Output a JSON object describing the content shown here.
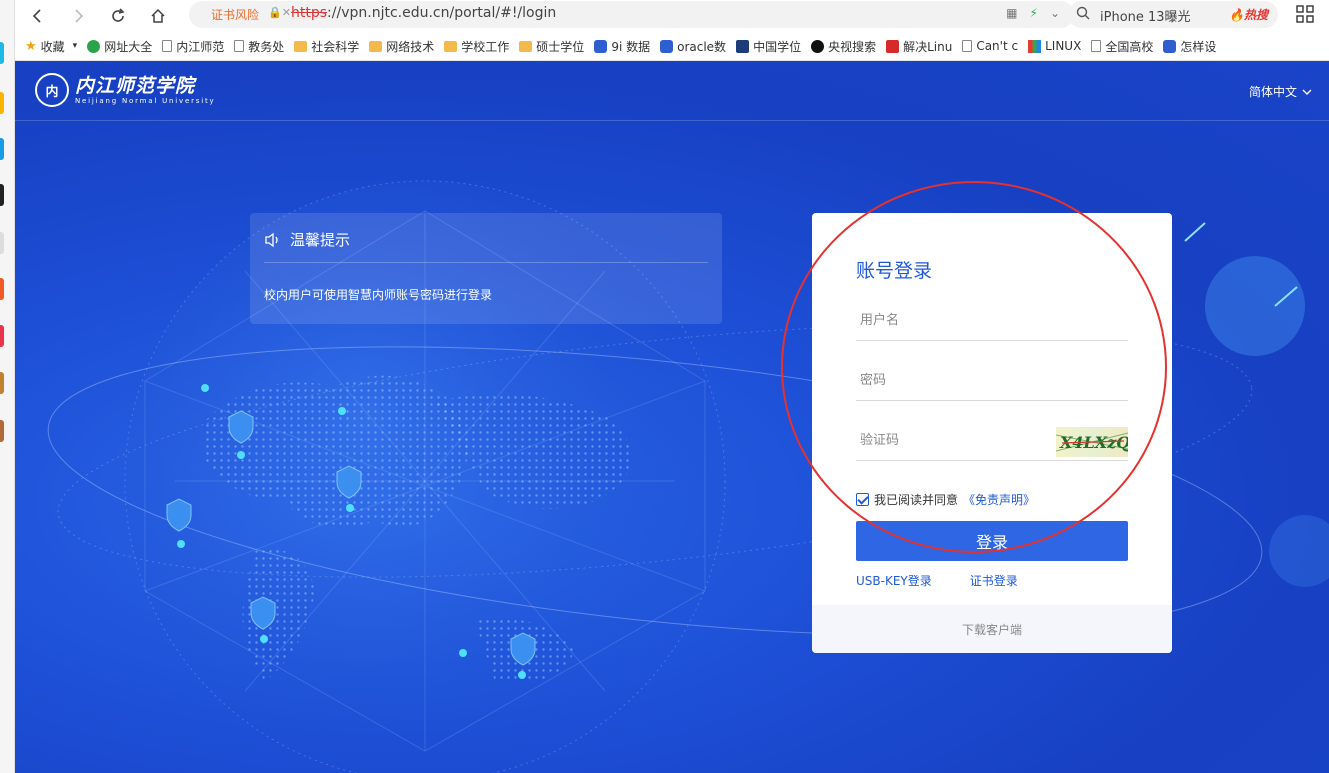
{
  "browser": {
    "cert_warning": "证书风险",
    "url_scheme": "https",
    "url_rest": "://vpn.njtc.edu.cn/portal/#!/login",
    "search_query": "iPhone 13曝光",
    "hot_badge": "热搜",
    "bookmarks": [
      {
        "label": "收藏",
        "icon": "star-icon"
      },
      {
        "label": "网址大全",
        "icon": "globe-icon"
      },
      {
        "label": "内江师范",
        "icon": "page-icon"
      },
      {
        "label": "教务处",
        "icon": "page-icon"
      },
      {
        "label": "社会科学",
        "icon": "folder-icon"
      },
      {
        "label": "网络技术",
        "icon": "folder-icon"
      },
      {
        "label": "学校工作",
        "icon": "folder-icon"
      },
      {
        "label": "硕士学位",
        "icon": "folder-icon"
      },
      {
        "label": "9i 数据",
        "icon": "paw-icon"
      },
      {
        "label": "oracle数",
        "icon": "paw-icon"
      },
      {
        "label": "中国学位",
        "icon": "graduation-icon"
      },
      {
        "label": "央视搜索",
        "icon": "cc-icon"
      },
      {
        "label": "解决Linu",
        "icon": "red-square-icon"
      },
      {
        "label": "Can't c",
        "icon": "weird-icon"
      },
      {
        "label": "LINUX",
        "icon": "multi-color-icon"
      },
      {
        "label": "全国高校",
        "icon": "page-icon"
      },
      {
        "label": "怎样设",
        "icon": "paw-icon"
      }
    ]
  },
  "header": {
    "school_name": "内江师范学院",
    "school_name_en": "Neijiang Normal University",
    "seal_text": "内",
    "language": "简体中文"
  },
  "notice": {
    "title": "温馨提示",
    "body": "校内用户可使用智慧内师账号密码进行登录"
  },
  "login": {
    "title": "账号登录",
    "username_placeholder": "用户名",
    "password_placeholder": "密码",
    "captcha_placeholder": "验证码",
    "captcha_text": "X4LXzQ",
    "agree_text": "我已阅读并同意",
    "disclaimer_link": "《免责声明》",
    "agree_checked": true,
    "submit_label": "登录",
    "usb_key_link": "USB-KEY登录",
    "cert_link": "证书登录",
    "download_client": "下载客户端"
  },
  "colors": {
    "page_bg": "#1d4fd6",
    "primary": "#2f66e4",
    "link": "#1f59d8",
    "annotation": "#e5312f"
  }
}
